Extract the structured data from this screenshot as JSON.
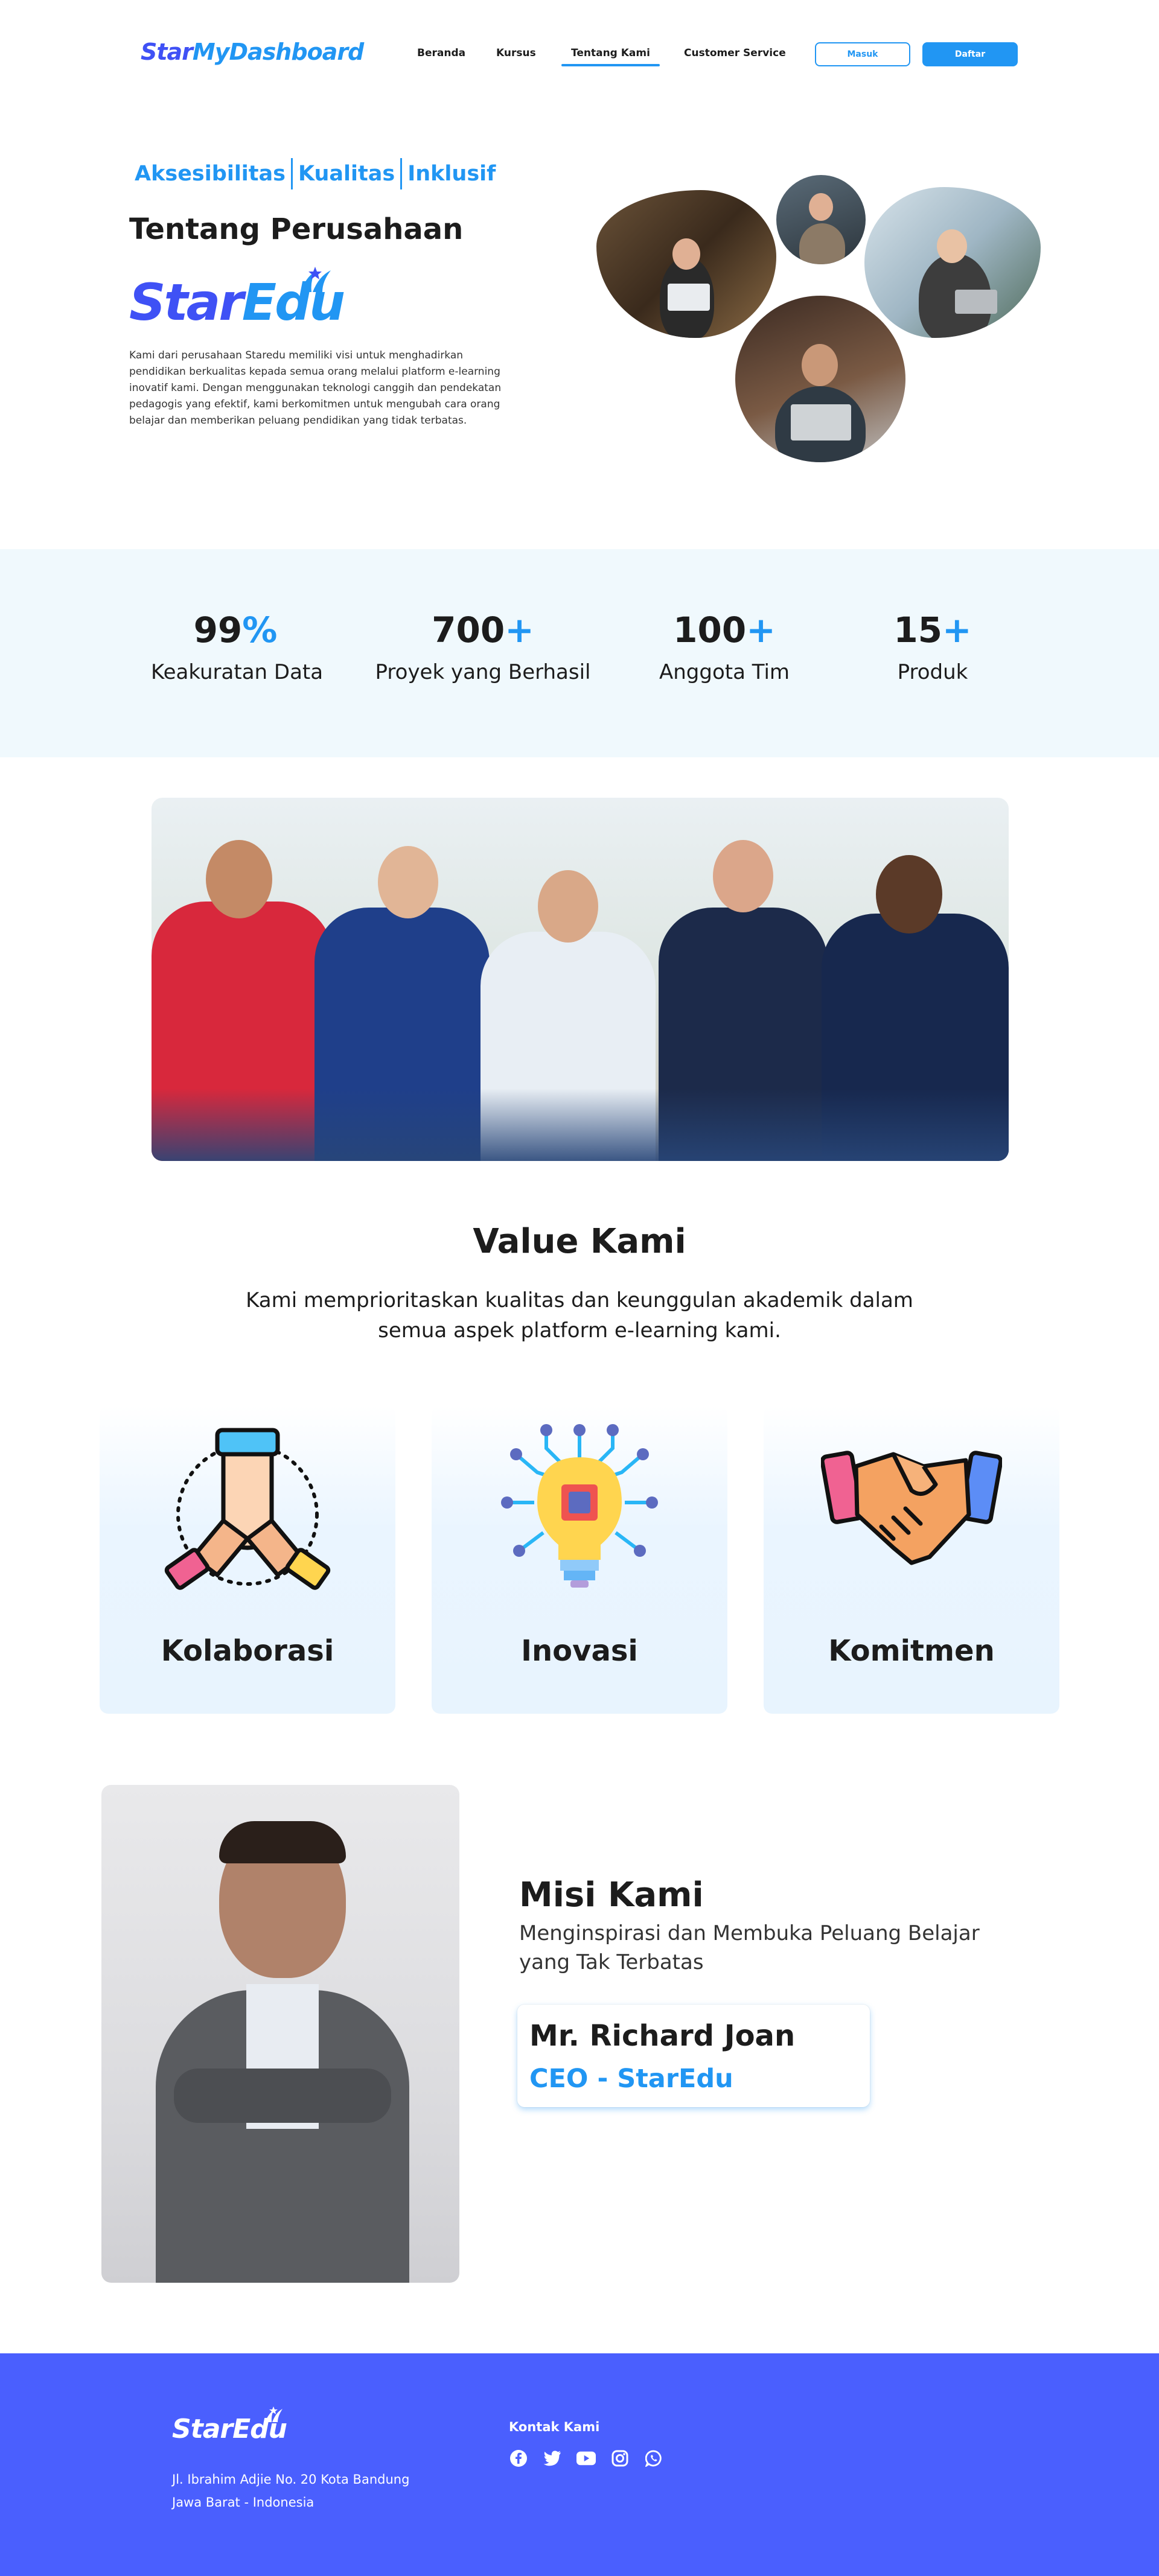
{
  "nav": {
    "logo_part1": "Star",
    "logo_part2": "MyDashboard",
    "links": [
      "Beranda",
      "Kursus",
      "Tentang Kami",
      "Customer Service"
    ],
    "active_link": "Tentang Kami",
    "login_label": "Masuk",
    "register_label": "Daftar"
  },
  "hero": {
    "tags": [
      "Aksesibilitas",
      "Kualitas",
      "Inklusif"
    ],
    "title": "Tentang Perusahaan",
    "logo_part1": "Star",
    "logo_part2": "Edu",
    "description": "Kami dari perusahaan Staredu memiliki visi untuk menghadirkan pendidikan berkualitas kepada semua orang melalui platform e-learning inovatif kami. Dengan menggunakan teknologi canggih dan pendekatan pedagogis yang efektif, kami berkomitmen untuk mengubah cara orang belajar dan memberikan peluang pendidikan yang tidak terbatas."
  },
  "stats": [
    {
      "number": "99",
      "suffix": "%",
      "label": "Keakuratan Data"
    },
    {
      "number": "700",
      "suffix": "+",
      "label": "Proyek yang Berhasil"
    },
    {
      "number": "100",
      "suffix": "+",
      "label": "Anggota Tim"
    },
    {
      "number": "15",
      "suffix": "+",
      "label": "Produk"
    }
  ],
  "values": {
    "title": "Value Kami",
    "description": "Kami memprioritaskan kualitas dan keunggulan akademik dalam semua aspek platform e-learning kami.",
    "cards": [
      {
        "label": "Kolaborasi",
        "icon": "teamwork-hands-icon"
      },
      {
        "label": "Inovasi",
        "icon": "lightbulb-chip-icon"
      },
      {
        "label": "Komitmen",
        "icon": "handshake-icon"
      }
    ]
  },
  "mission": {
    "title": "Misi Kami",
    "subtitle": "Menginspirasi dan Membuka Peluang Belajar yang Tak Terbatas",
    "ceo_name": "Mr. Richard Joan",
    "ceo_role": "CEO - StarEdu"
  },
  "footer": {
    "logo": "StarEdu",
    "address_line1": "Jl. Ibrahim Adjie No. 20 Kota Bandung",
    "address_line2": "Jawa Barat - Indonesia",
    "contact_title": "Kontak Kami",
    "socials": [
      "facebook-icon",
      "twitter-icon",
      "youtube-icon",
      "instagram-icon",
      "whatsapp-icon"
    ]
  },
  "colors": {
    "primary": "#2196f3",
    "brand_indigo": "#3f51f5",
    "footer_bg": "#4a5ffe",
    "stats_bg": "#f0f9fd"
  }
}
